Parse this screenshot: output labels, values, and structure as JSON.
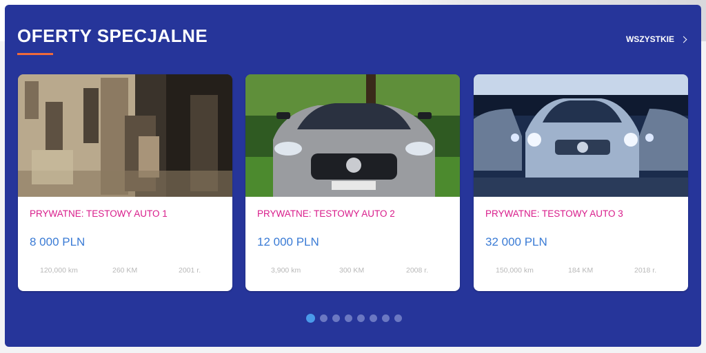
{
  "section": {
    "title": "OFERTY SPECJALNE",
    "all_link_label": "WSZYSTKIE"
  },
  "offers": [
    {
      "name": "PRYWATNE: TESTOWY AUTO 1",
      "price": "8 000 PLN",
      "mileage": "120,000 km",
      "power": "260 KM",
      "year": "2001 r."
    },
    {
      "name": "PRYWATNE: TESTOWY AUTO 2",
      "price": "12 000 PLN",
      "mileage": "3,900 km",
      "power": "300 KM",
      "year": "2008 r."
    },
    {
      "name": "PRYWATNE: TESTOWY AUTO 3",
      "price": "32 000 PLN",
      "mileage": "150,000 km",
      "power": "184 KM",
      "year": "2018 r."
    }
  ],
  "carousel": {
    "dot_count": 8,
    "active_index": 0
  },
  "colors": {
    "panel_bg": "#26359a",
    "accent_underline": "#f06a3a",
    "car_name": "#d81b8a",
    "price": "#3a7bd5",
    "dot_active": "#4a9aea",
    "dot_inactive": "#6b78c2"
  }
}
